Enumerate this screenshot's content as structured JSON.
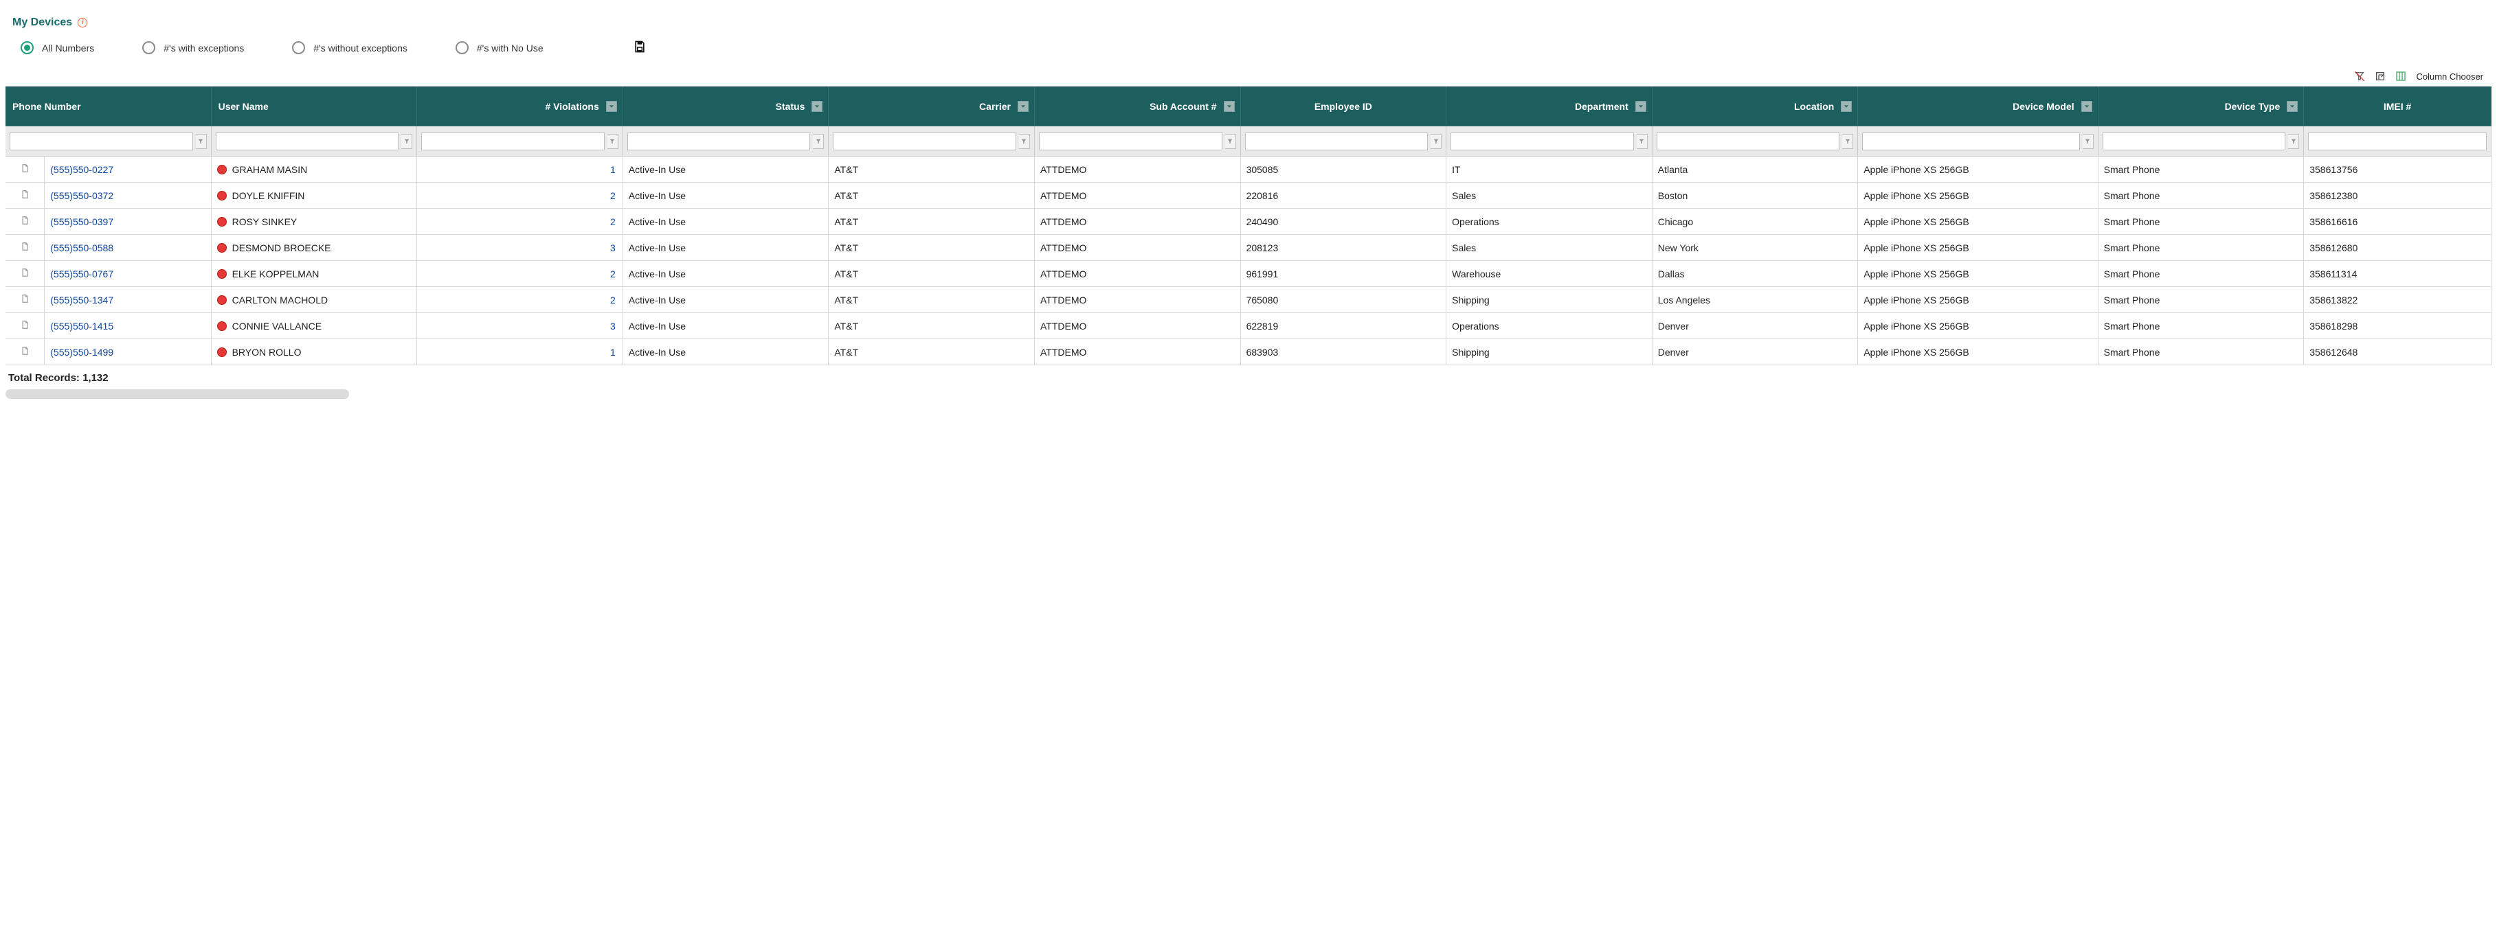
{
  "title": "My Devices",
  "filters": {
    "options": [
      {
        "id": "all",
        "label": "All Numbers",
        "selected": true
      },
      {
        "id": "withex",
        "label": "#'s with exceptions",
        "selected": false
      },
      {
        "id": "withoutex",
        "label": "#'s without exceptions",
        "selected": false
      },
      {
        "id": "nouse",
        "label": "#'s with No Use",
        "selected": false
      }
    ],
    "save_label": "Save"
  },
  "toolbar": {
    "clear_filters_tooltip": "Clear Filters",
    "export_tooltip": "Export",
    "column_chooser_label": "Column Chooser"
  },
  "columns": [
    {
      "key": "phone",
      "label": "Phone Number",
      "align": "left",
      "drop": false
    },
    {
      "key": "user",
      "label": "User Name",
      "align": "left",
      "drop": false
    },
    {
      "key": "viol",
      "label": "# Violations",
      "align": "right",
      "drop": true
    },
    {
      "key": "status",
      "label": "Status",
      "align": "right",
      "drop": true
    },
    {
      "key": "carrier",
      "label": "Carrier",
      "align": "right",
      "drop": true
    },
    {
      "key": "sub",
      "label": "Sub Account #",
      "align": "right",
      "drop": true
    },
    {
      "key": "emp",
      "label": "Employee ID",
      "align": "center",
      "drop": false
    },
    {
      "key": "dept",
      "label": "Department",
      "align": "right",
      "drop": true
    },
    {
      "key": "loc",
      "label": "Location",
      "align": "right",
      "drop": true
    },
    {
      "key": "model",
      "label": "Device Model",
      "align": "right",
      "drop": true
    },
    {
      "key": "type",
      "label": "Device Type",
      "align": "right",
      "drop": true
    },
    {
      "key": "imei",
      "label": "IMEI #",
      "align": "center",
      "drop": false
    }
  ],
  "rows": [
    {
      "phone": "(555)550-0227",
      "user": "GRAHAM MASIN",
      "viol": 1,
      "status": "Active-In Use",
      "carrier": "AT&T",
      "sub": "ATTDEMO",
      "emp": "305085",
      "dept": "IT",
      "loc": "Atlanta",
      "model": "Apple iPhone XS 256GB",
      "type": "Smart Phone",
      "imei": "358613756"
    },
    {
      "phone": "(555)550-0372",
      "user": "DOYLE KNIFFIN",
      "viol": 2,
      "status": "Active-In Use",
      "carrier": "AT&T",
      "sub": "ATTDEMO",
      "emp": "220816",
      "dept": "Sales",
      "loc": "Boston",
      "model": "Apple iPhone XS 256GB",
      "type": "Smart Phone",
      "imei": "358612380"
    },
    {
      "phone": "(555)550-0397",
      "user": "ROSY SINKEY",
      "viol": 2,
      "status": "Active-In Use",
      "carrier": "AT&T",
      "sub": "ATTDEMO",
      "emp": "240490",
      "dept": "Operations",
      "loc": "Chicago",
      "model": "Apple iPhone XS 256GB",
      "type": "Smart Phone",
      "imei": "358616616"
    },
    {
      "phone": "(555)550-0588",
      "user": "DESMOND BROECKE",
      "viol": 3,
      "status": "Active-In Use",
      "carrier": "AT&T",
      "sub": "ATTDEMO",
      "emp": "208123",
      "dept": "Sales",
      "loc": "New York",
      "model": "Apple iPhone XS 256GB",
      "type": "Smart Phone",
      "imei": "358612680"
    },
    {
      "phone": "(555)550-0767",
      "user": "ELKE KOPPELMAN",
      "viol": 2,
      "status": "Active-In Use",
      "carrier": "AT&T",
      "sub": "ATTDEMO",
      "emp": "961991",
      "dept": "Warehouse",
      "loc": "Dallas",
      "model": "Apple iPhone XS 256GB",
      "type": "Smart Phone",
      "imei": "358611314"
    },
    {
      "phone": "(555)550-1347",
      "user": "CARLTON MACHOLD",
      "viol": 2,
      "status": "Active-In Use",
      "carrier": "AT&T",
      "sub": "ATTDEMO",
      "emp": "765080",
      "dept": "Shipping",
      "loc": "Los Angeles",
      "model": "Apple iPhone XS 256GB",
      "type": "Smart Phone",
      "imei": "358613822"
    },
    {
      "phone": "(555)550-1415",
      "user": "CONNIE VALLANCE",
      "viol": 3,
      "status": "Active-In Use",
      "carrier": "AT&T",
      "sub": "ATTDEMO",
      "emp": "622819",
      "dept": "Operations",
      "loc": "Denver",
      "model": "Apple iPhone XS 256GB",
      "type": "Smart Phone",
      "imei": "358618298"
    },
    {
      "phone": "(555)550-1499",
      "user": "BRYON ROLLO",
      "viol": 1,
      "status": "Active-In Use",
      "carrier": "AT&T",
      "sub": "ATTDEMO",
      "emp": "683903",
      "dept": "Shipping",
      "loc": "Denver",
      "model": "Apple iPhone XS 256GB",
      "type": "Smart Phone",
      "imei": "358612648"
    }
  ],
  "footer": {
    "total_label": "Total Records:",
    "total_value": "1,132"
  }
}
